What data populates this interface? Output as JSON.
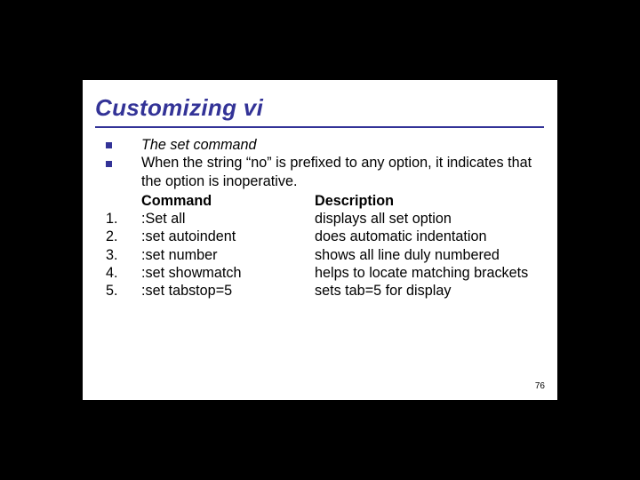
{
  "title": "Customizing vi",
  "subtitle": "The set command",
  "lead": "When the string “no” is prefixed to any option, it indicates that the option is inoperative.",
  "headers": {
    "command": "Command",
    "description": "Description"
  },
  "items": [
    {
      "n": "1.",
      "command": ":Set all",
      "description": "displays all set option"
    },
    {
      "n": "2.",
      "command": ":set autoindent",
      "description": "does automatic indentation"
    },
    {
      "n": "3.",
      "command": ":set number",
      "description": "shows all line duly numbered"
    },
    {
      "n": "4.",
      "command": ":set showmatch",
      "description": "helps to locate matching brackets"
    },
    {
      "n": "5.",
      "command": ":set tabstop=5",
      "description": "sets tab=5 for display"
    }
  ],
  "page_number": "76"
}
